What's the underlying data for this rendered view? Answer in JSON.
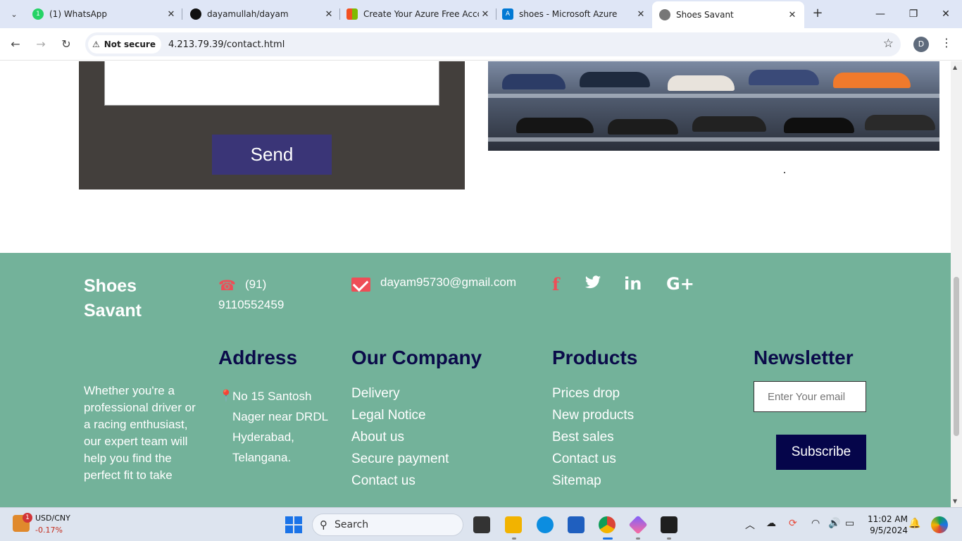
{
  "browser": {
    "tabs": [
      {
        "title": "(1) WhatsApp",
        "icon": "whatsapp-icon",
        "color": "#25d366"
      },
      {
        "title": "dayamullah/dayam",
        "icon": "github-icon",
        "color": "#111111"
      },
      {
        "title": "Create Your Azure Free Acco",
        "icon": "microsoft-icon",
        "color": "#f25022"
      },
      {
        "title": "shoes - Microsoft Azure",
        "icon": "azure-icon",
        "color": "#0078d4"
      },
      {
        "title": "Shoes Savant",
        "icon": "globe-icon",
        "color": "#555555"
      }
    ],
    "security_label": "Not secure",
    "url": "4.213.79.39/contact.html",
    "profile_initial": "D"
  },
  "contact_form": {
    "send_label": "Send"
  },
  "footer": {
    "brand": "Shoes Savant",
    "phone": "(91) 9110552459",
    "email": "dayam95730@gmail.com",
    "description": "Whether you're a professional driver or a racing enthusiast, our expert team will help you find the perfect fit to take",
    "address_heading": "Address",
    "address": "No 15 Santosh Nager near DRDL Hyderabad, Telangana.",
    "company_heading": "Our Company",
    "company_links": [
      "Delivery",
      "Legal Notice",
      "About us",
      "Secure payment",
      "Contact us"
    ],
    "products_heading": "Products",
    "products_links": [
      "Prices drop",
      "New products",
      "Best sales",
      "Contact us",
      "Sitemap"
    ],
    "newsletter_heading": "Newsletter",
    "newsletter_placeholder": "Enter Your email",
    "subscribe_label": "Subscribe",
    "social": {
      "facebook": "f",
      "linkedin": "in",
      "google": "G+"
    }
  },
  "taskbar": {
    "ticker_name": "USD/CNY",
    "ticker_change": "-0.17%",
    "notification_count": "1",
    "search_label": "Search",
    "time": "11:02 AM",
    "date": "9/5/2024"
  },
  "colors": {
    "footer_bg": "#73b29a",
    "heading": "#0b0b4a",
    "accent_red": "#ee4e57",
    "send_button": "#3a3577",
    "subscribe_button": "#05054a"
  }
}
